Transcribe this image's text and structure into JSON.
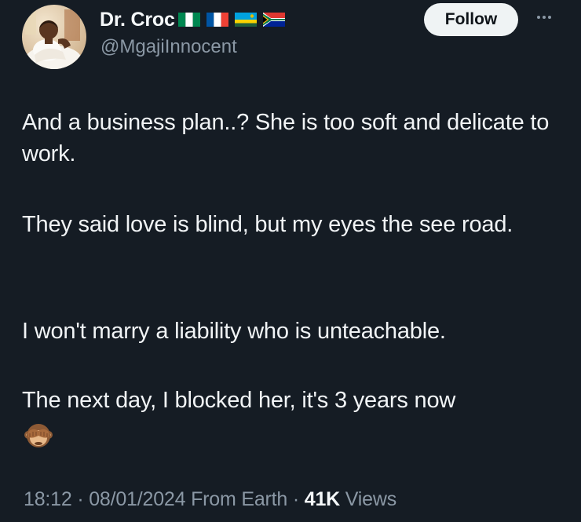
{
  "author": {
    "display_name": "Dr. Croc",
    "handle": "@MgajiInnocent",
    "flags": [
      "nigeria-flag-icon",
      "france-flag-icon",
      "rwanda-flag-icon",
      "south-africa-flag-icon"
    ]
  },
  "actions": {
    "follow_label": "Follow",
    "more_icon": "more-options-icon"
  },
  "post": {
    "paragraphs": [
      "And a business plan..? She is too soft and delicate to work.",
      "They said love is blind, but my eyes the see road.",
      "I won't marry a liability who is unteachable.",
      "The next day, I blocked her, it's 3 years now"
    ],
    "emoji": "see-no-evil-monkey-icon"
  },
  "meta": {
    "time": "18:12",
    "separator": "·",
    "date": "08/01/2024",
    "source": "From Earth",
    "views_count": "41K",
    "views_label": "Views"
  },
  "colors": {
    "background": "#151c24",
    "text_primary": "#f1f4f6",
    "text_secondary": "#8b98a5",
    "follow_bg": "#eff3f4"
  }
}
